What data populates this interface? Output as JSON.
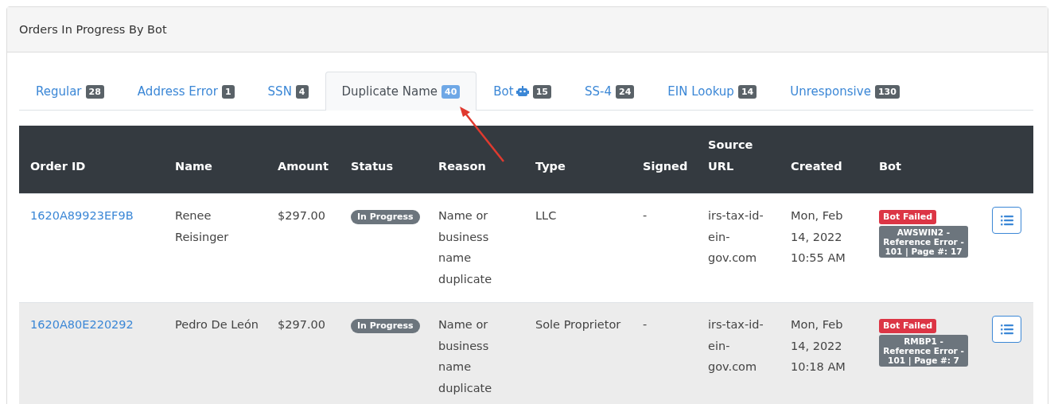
{
  "card": {
    "title": "Orders In Progress By Bot"
  },
  "tabs": [
    {
      "label": "Regular",
      "count": "28",
      "selected": false
    },
    {
      "label": "Address Error",
      "count": "1",
      "selected": false
    },
    {
      "label": "SSN",
      "count": "4",
      "selected": false
    },
    {
      "label": "Duplicate Name",
      "count": "40",
      "selected": true
    },
    {
      "label": "Bot",
      "count": "15",
      "selected": false,
      "kind": "robot"
    },
    {
      "label": "SS-4",
      "count": "24",
      "selected": false
    },
    {
      "label": "EIN Lookup",
      "count": "14",
      "selected": false
    },
    {
      "label": "Unresponsive",
      "count": "130",
      "selected": false
    }
  ],
  "table": {
    "columns": [
      "Order ID",
      "Name",
      "Amount",
      "Status",
      "Reason",
      "Type",
      "Signed",
      "Source URL",
      "Created",
      "Bot"
    ],
    "rows": [
      {
        "order_id": "1620A89923EF9B",
        "name": "Renee Reisinger",
        "amount": "$297.00",
        "status": "In Progress",
        "reason": "Name or business name duplicate",
        "type": "LLC",
        "signed": "-",
        "source_url": "irs-tax-id-ein-gov.com",
        "created": "Mon, Feb 14, 2022 10:55 AM",
        "bot_status": "Bot Failed",
        "bot_detail": "AWSWIN2 - Reference Error - 101 | Page #: 17"
      },
      {
        "order_id": "1620A80E220292",
        "name": "Pedro De León",
        "amount": "$297.00",
        "status": "In Progress",
        "reason": "Name or business name duplicate",
        "type": "Sole Proprietor",
        "signed": "-",
        "source_url": "irs-tax-id-ein-gov.com",
        "created": "Mon, Feb 14, 2022 10:18 AM",
        "bot_status": "Bot Failed",
        "bot_detail": "RMBP1 - Reference Error - 101 | Page #: 7"
      }
    ]
  }
}
